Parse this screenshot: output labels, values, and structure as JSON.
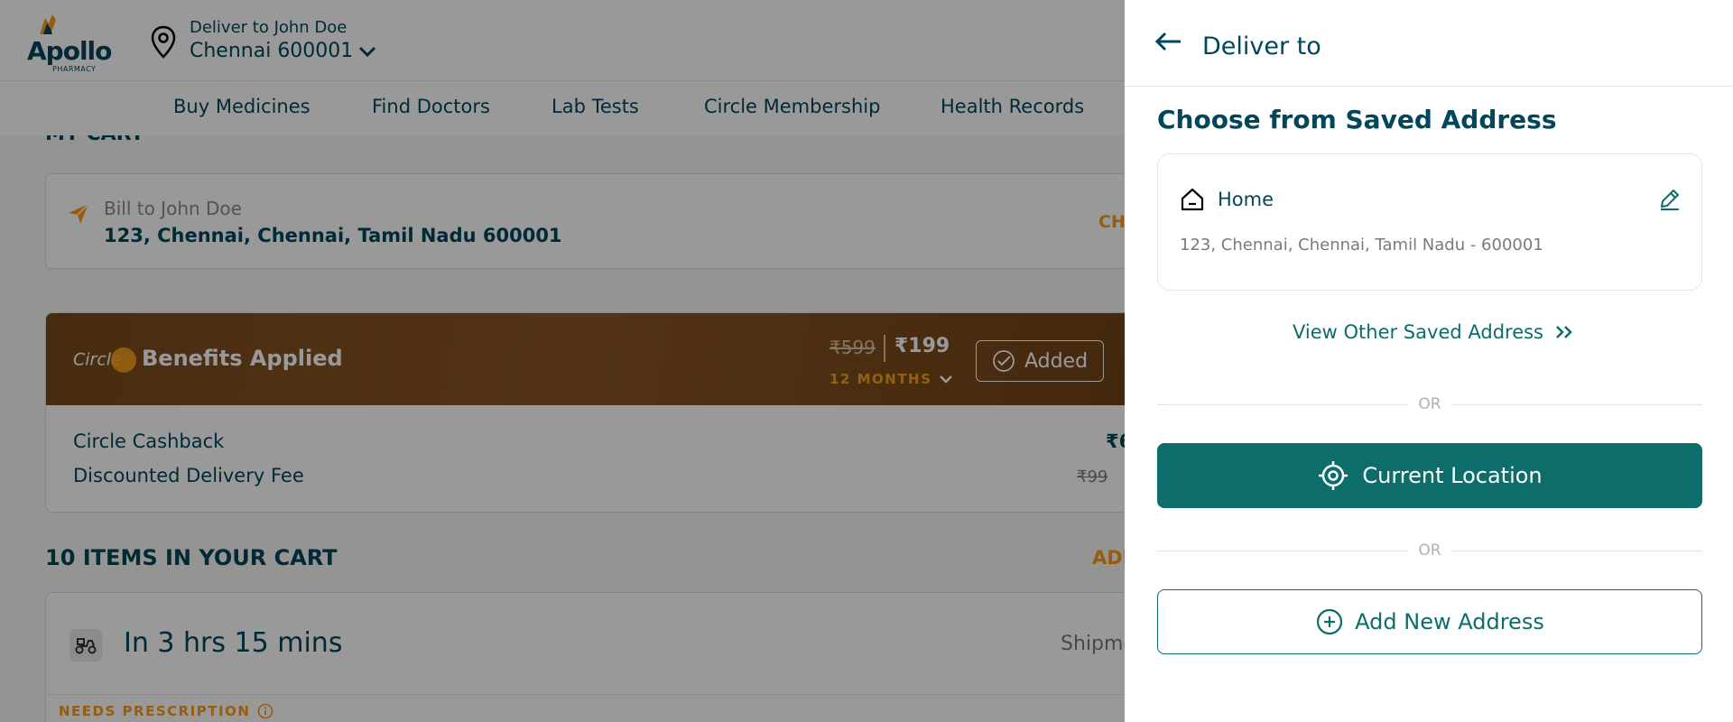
{
  "header": {
    "logo_brand": "Apollo",
    "logo_sub": "PHARMACY",
    "deliver_to_label": "Deliver to John Doe",
    "location": "Chennai 600001"
  },
  "nav": {
    "items": [
      "Buy Medicines",
      "Find Doctors",
      "Lab Tests",
      "Circle Membership",
      "Health Records"
    ]
  },
  "cart": {
    "heading": "MY CART",
    "bill_to": "Bill to John Doe",
    "bill_address": "123, Chennai, Chennai, Tamil Nadu 600001",
    "change_label": "CH"
  },
  "circle": {
    "logo_text": "Circle",
    "benefits_label": "Benefits Applied",
    "price_old": "₹599",
    "price_new": "₹199",
    "duration": "12 MONTHS",
    "added_label": "Added",
    "cashback_label": "Circle Cashback",
    "cashback_value": "₹6",
    "delivery_label": "Discounted Delivery Fee",
    "delivery_old": "₹99"
  },
  "items": {
    "heading": "10 ITEMS IN YOUR CART",
    "add_label": "ADI",
    "shipment_time": "In 3 hrs 15 mins",
    "shipment_label": "Shipme",
    "needs_prescription": "NEEDS PRESCRIPTION"
  },
  "drawer": {
    "title": "Deliver to",
    "saved_heading": "Choose from Saved Address",
    "saved_address": {
      "label": "Home",
      "address": "123, Chennai, Chennai, Tamil Nadu - 600001"
    },
    "view_other": "View Other Saved Address",
    "or_text": "OR",
    "current_location": "Current Location",
    "add_new": "Add New Address"
  },
  "colors": {
    "primary_teal": "#0c6d6a",
    "brand_dark": "#01475b",
    "accent_orange": "#fc9916",
    "circle_brown": "#7a4a1c"
  },
  "icons": [
    "apollo-bird-icon",
    "location-pin-icon",
    "chevron-down-icon",
    "paper-plane-icon",
    "check-circle-icon",
    "scooter-icon",
    "info-icon",
    "back-arrow-icon",
    "home-icon",
    "edit-pencil-icon",
    "double-chevron-right-icon",
    "target-location-icon",
    "plus-circle-icon"
  ]
}
